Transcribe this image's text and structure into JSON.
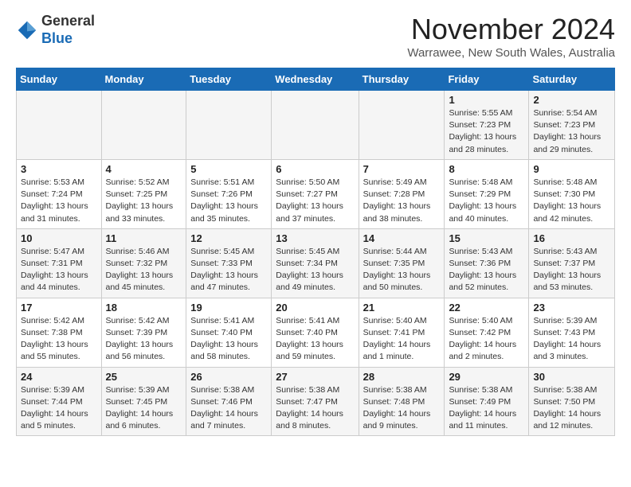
{
  "header": {
    "logo_line1": "General",
    "logo_line2": "Blue",
    "month_title": "November 2024",
    "location": "Warrawee, New South Wales, Australia"
  },
  "days_of_week": [
    "Sunday",
    "Monday",
    "Tuesday",
    "Wednesday",
    "Thursday",
    "Friday",
    "Saturday"
  ],
  "weeks": [
    [
      {
        "day": "",
        "info": ""
      },
      {
        "day": "",
        "info": ""
      },
      {
        "day": "",
        "info": ""
      },
      {
        "day": "",
        "info": ""
      },
      {
        "day": "",
        "info": ""
      },
      {
        "day": "1",
        "info": "Sunrise: 5:55 AM\nSunset: 7:23 PM\nDaylight: 13 hours\nand 28 minutes."
      },
      {
        "day": "2",
        "info": "Sunrise: 5:54 AM\nSunset: 7:23 PM\nDaylight: 13 hours\nand 29 minutes."
      }
    ],
    [
      {
        "day": "3",
        "info": "Sunrise: 5:53 AM\nSunset: 7:24 PM\nDaylight: 13 hours\nand 31 minutes."
      },
      {
        "day": "4",
        "info": "Sunrise: 5:52 AM\nSunset: 7:25 PM\nDaylight: 13 hours\nand 33 minutes."
      },
      {
        "day": "5",
        "info": "Sunrise: 5:51 AM\nSunset: 7:26 PM\nDaylight: 13 hours\nand 35 minutes."
      },
      {
        "day": "6",
        "info": "Sunrise: 5:50 AM\nSunset: 7:27 PM\nDaylight: 13 hours\nand 37 minutes."
      },
      {
        "day": "7",
        "info": "Sunrise: 5:49 AM\nSunset: 7:28 PM\nDaylight: 13 hours\nand 38 minutes."
      },
      {
        "day": "8",
        "info": "Sunrise: 5:48 AM\nSunset: 7:29 PM\nDaylight: 13 hours\nand 40 minutes."
      },
      {
        "day": "9",
        "info": "Sunrise: 5:48 AM\nSunset: 7:30 PM\nDaylight: 13 hours\nand 42 minutes."
      }
    ],
    [
      {
        "day": "10",
        "info": "Sunrise: 5:47 AM\nSunset: 7:31 PM\nDaylight: 13 hours\nand 44 minutes."
      },
      {
        "day": "11",
        "info": "Sunrise: 5:46 AM\nSunset: 7:32 PM\nDaylight: 13 hours\nand 45 minutes."
      },
      {
        "day": "12",
        "info": "Sunrise: 5:45 AM\nSunset: 7:33 PM\nDaylight: 13 hours\nand 47 minutes."
      },
      {
        "day": "13",
        "info": "Sunrise: 5:45 AM\nSunset: 7:34 PM\nDaylight: 13 hours\nand 49 minutes."
      },
      {
        "day": "14",
        "info": "Sunrise: 5:44 AM\nSunset: 7:35 PM\nDaylight: 13 hours\nand 50 minutes."
      },
      {
        "day": "15",
        "info": "Sunrise: 5:43 AM\nSunset: 7:36 PM\nDaylight: 13 hours\nand 52 minutes."
      },
      {
        "day": "16",
        "info": "Sunrise: 5:43 AM\nSunset: 7:37 PM\nDaylight: 13 hours\nand 53 minutes."
      }
    ],
    [
      {
        "day": "17",
        "info": "Sunrise: 5:42 AM\nSunset: 7:38 PM\nDaylight: 13 hours\nand 55 minutes."
      },
      {
        "day": "18",
        "info": "Sunrise: 5:42 AM\nSunset: 7:39 PM\nDaylight: 13 hours\nand 56 minutes."
      },
      {
        "day": "19",
        "info": "Sunrise: 5:41 AM\nSunset: 7:40 PM\nDaylight: 13 hours\nand 58 minutes."
      },
      {
        "day": "20",
        "info": "Sunrise: 5:41 AM\nSunset: 7:40 PM\nDaylight: 13 hours\nand 59 minutes."
      },
      {
        "day": "21",
        "info": "Sunrise: 5:40 AM\nSunset: 7:41 PM\nDaylight: 14 hours\nand 1 minute."
      },
      {
        "day": "22",
        "info": "Sunrise: 5:40 AM\nSunset: 7:42 PM\nDaylight: 14 hours\nand 2 minutes."
      },
      {
        "day": "23",
        "info": "Sunrise: 5:39 AM\nSunset: 7:43 PM\nDaylight: 14 hours\nand 3 minutes."
      }
    ],
    [
      {
        "day": "24",
        "info": "Sunrise: 5:39 AM\nSunset: 7:44 PM\nDaylight: 14 hours\nand 5 minutes."
      },
      {
        "day": "25",
        "info": "Sunrise: 5:39 AM\nSunset: 7:45 PM\nDaylight: 14 hours\nand 6 minutes."
      },
      {
        "day": "26",
        "info": "Sunrise: 5:38 AM\nSunset: 7:46 PM\nDaylight: 14 hours\nand 7 minutes."
      },
      {
        "day": "27",
        "info": "Sunrise: 5:38 AM\nSunset: 7:47 PM\nDaylight: 14 hours\nand 8 minutes."
      },
      {
        "day": "28",
        "info": "Sunrise: 5:38 AM\nSunset: 7:48 PM\nDaylight: 14 hours\nand 9 minutes."
      },
      {
        "day": "29",
        "info": "Sunrise: 5:38 AM\nSunset: 7:49 PM\nDaylight: 14 hours\nand 11 minutes."
      },
      {
        "day": "30",
        "info": "Sunrise: 5:38 AM\nSunset: 7:50 PM\nDaylight: 14 hours\nand 12 minutes."
      }
    ]
  ]
}
